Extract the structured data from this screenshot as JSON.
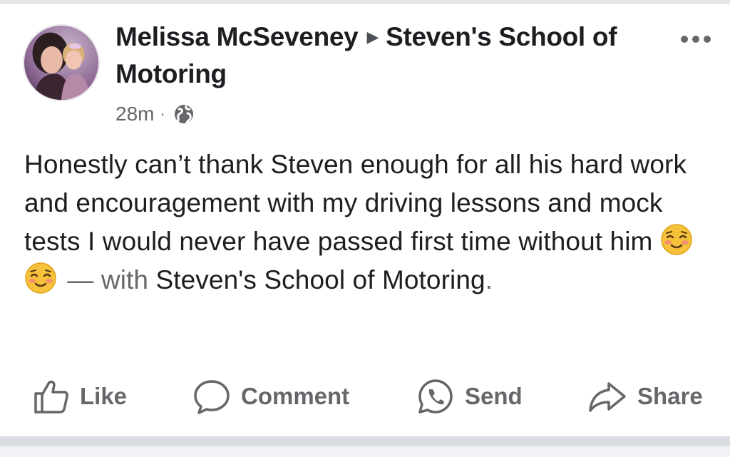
{
  "post": {
    "author": "Melissa McSeveney",
    "target": "Steven's School of Motoring",
    "time": "28m",
    "separator": "·",
    "audience_icon": "globe-icon",
    "body_text": "Honestly can’t thank Steven enough for all his hard work and encouragement with my driving lessons and mock tests I would never have passed first time without him",
    "emojis": [
      "relieved-face-emoji",
      "relieved-face-emoji"
    ],
    "with_prefix": "— with",
    "with_page": "Steven's School of Motoring",
    "with_suffix": "."
  },
  "actions": {
    "like": "Like",
    "comment": "Comment",
    "send": "Send",
    "share": "Share"
  },
  "colors": {
    "primary_text": "#1c1e21",
    "secondary_text": "#65676b",
    "divider": "#dadde1"
  }
}
